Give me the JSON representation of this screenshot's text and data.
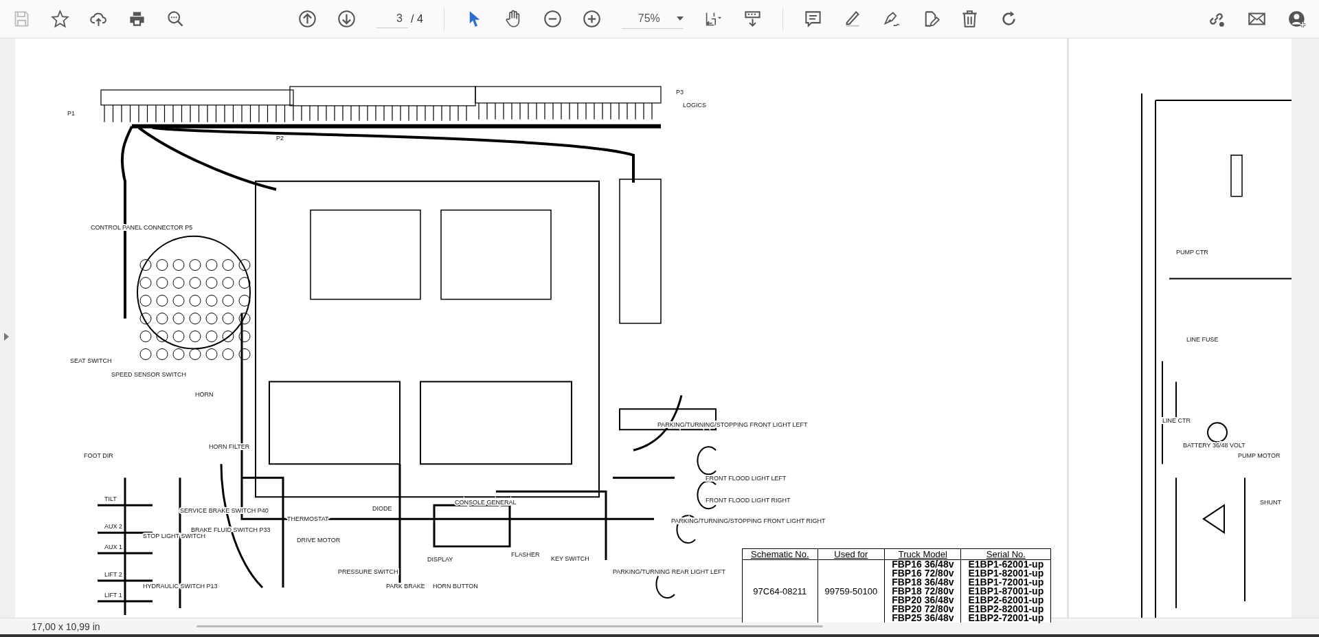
{
  "toolbar": {
    "page_current": "3",
    "page_total": "/ 4",
    "zoom": "75%",
    "tools": [
      {
        "kind": "pointer",
        "selected": true
      },
      {
        "kind": "hand",
        "selected": false
      }
    ]
  },
  "schematic_labels": [
    "P1",
    "P2",
    "P3",
    "LOGICS",
    "CONTROL PANEL CONNECTOR P5",
    "SEAT SWITCH",
    "SPEED SENSOR SWITCH",
    "HORN",
    "HORN FILTER",
    "DRIVE MOTOR",
    "DISPLAY",
    "FLASHER",
    "SERVICE BRAKE SWITCH P40",
    "BRAKE FLUID SWITCH P33",
    "HYDRAULIC SWITCH P13",
    "TILT",
    "AUX 2",
    "AUX 1",
    "LIFT 2",
    "LIFT 1",
    "STOP LIGHT SWITCH",
    "FOOT DIR",
    "FRONT FLOOD LIGHT LEFT",
    "FRONT FLOOD LIGHT RIGHT",
    "PARKING/TURNING/STOPPING FRONT LIGHT LEFT",
    "PARKING/TURNING/STOPPING FRONT LIGHT RIGHT",
    "PARKING/TURNING REAR LIGHT LEFT",
    "PUMP CTR",
    "LINE FUSE",
    "LINE CTR",
    "BATTERY 36/48 VOLT",
    "PUMP MOTOR",
    "SHUNT",
    "DIODE",
    "THERMOSTAT",
    "CONSOLE GENERAL",
    "KEY SWITCH",
    "PARK BRAKE",
    "HORN BUTTON",
    "PRESSURE SWITCH"
  ],
  "table": {
    "columns": [
      "Schematic No.",
      "Used for",
      "Truck Model",
      "Serial No."
    ],
    "schematic_no": "97C64-08211",
    "used_for": "99759-50100",
    "rows": [
      {
        "model": "FBP16 36/48v",
        "serial": "E1BP1-62001-up"
      },
      {
        "model": "FBP16 72/80v",
        "serial": "E1BP1-82001-up"
      },
      {
        "model": "FBP18 36/48v",
        "serial": "E1BP1-72001-up"
      },
      {
        "model": "FBP18 72/80v",
        "serial": "E1BP1-87001-up"
      },
      {
        "model": "FBP20 36/48v",
        "serial": "E1BP2-62001-up"
      },
      {
        "model": "FBP20 72/80v",
        "serial": "E1BP2-82001-up"
      },
      {
        "model": "FBP25 36/48v",
        "serial": "E1BP2-72001-up"
      }
    ]
  },
  "status_bar": {
    "page_size": "17,00 x 10,99 in"
  }
}
